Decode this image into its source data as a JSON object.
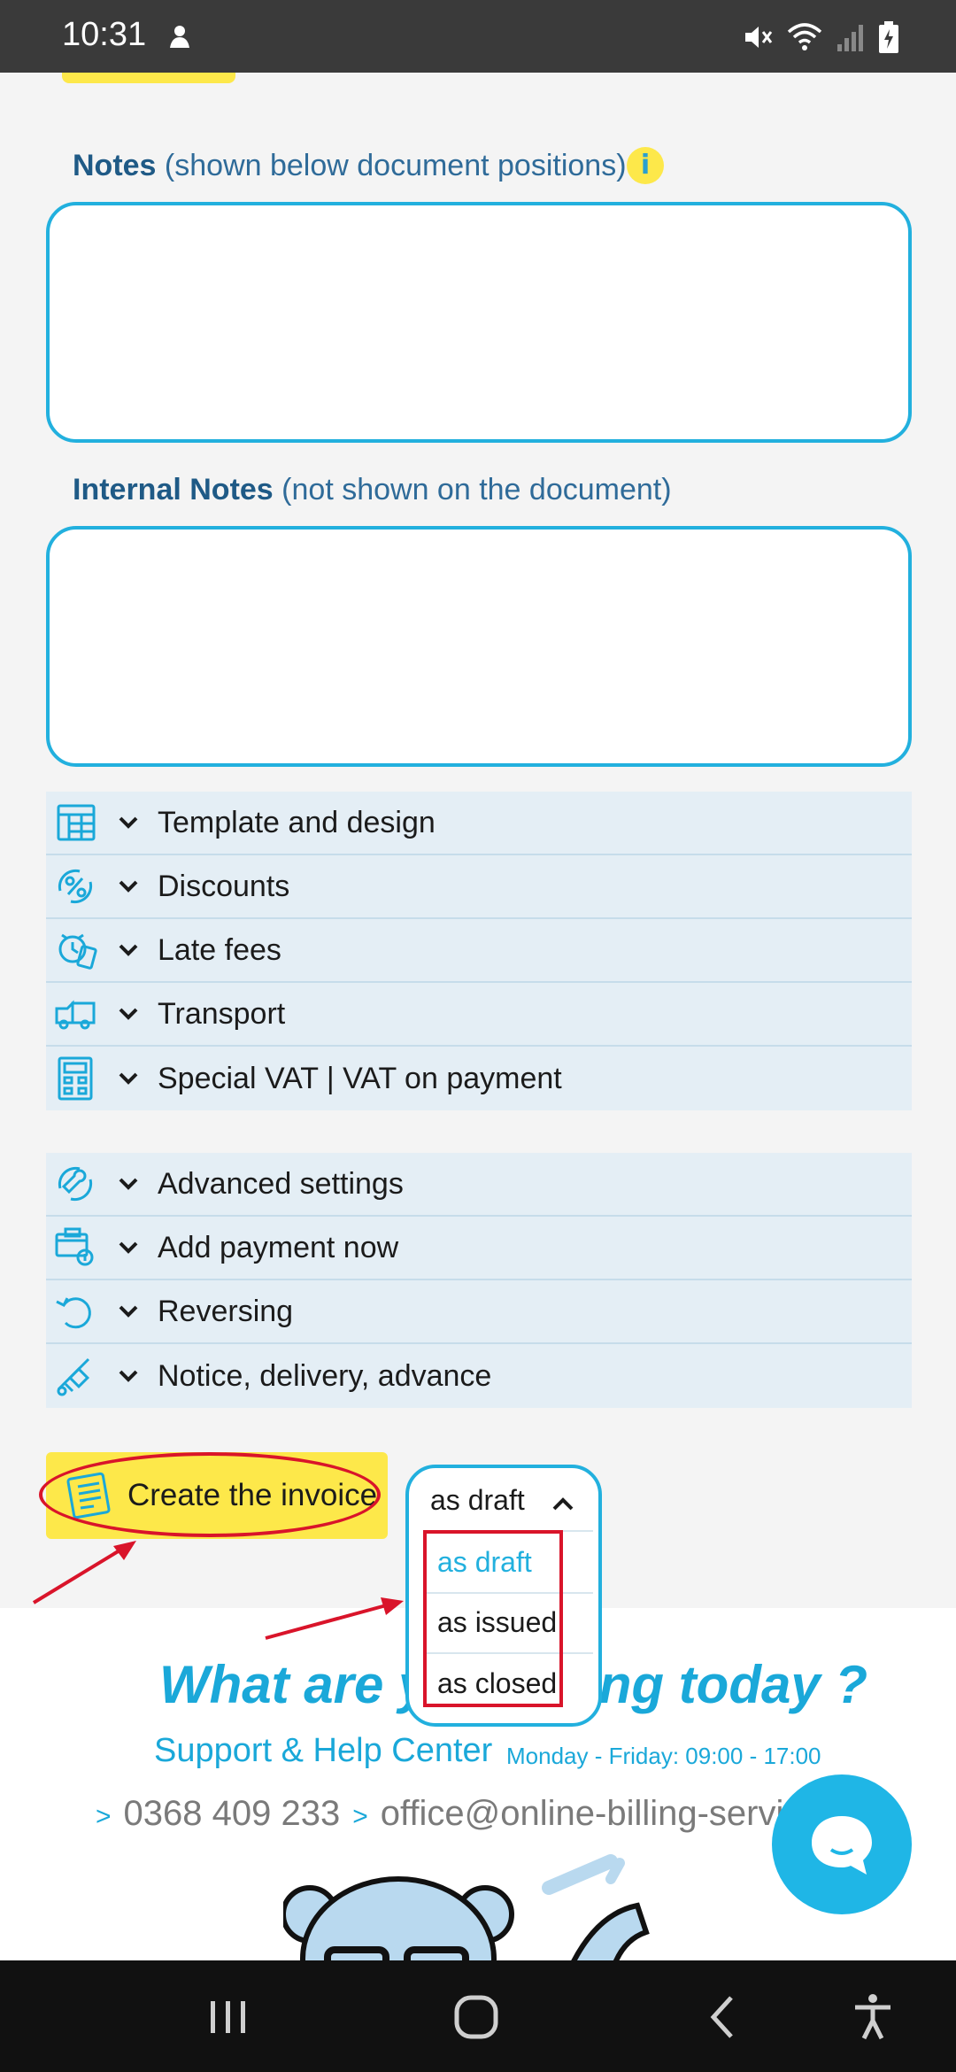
{
  "status_bar": {
    "time": "10:31"
  },
  "notes": {
    "label_bold": "Notes",
    "label_hint": "(shown below document positions)",
    "info_glyph": "i",
    "value": ""
  },
  "internal_notes": {
    "label_bold": "Internal Notes",
    "label_hint": "(not shown on the document)",
    "value": ""
  },
  "accordion_group_1": [
    {
      "label": "Template and design",
      "icon": "template-grid-icon"
    },
    {
      "label": "Discounts",
      "icon": "discount-percent-icon"
    },
    {
      "label": "Late fees",
      "icon": "late-fee-clock-icon"
    },
    {
      "label": "Transport",
      "icon": "truck-icon"
    },
    {
      "label": "Special VAT | VAT on payment",
      "icon": "calculator-icon"
    }
  ],
  "accordion_group_2": [
    {
      "label": "Advanced settings",
      "icon": "wrench-icon"
    },
    {
      "label": "Add payment now",
      "icon": "payment-card-icon"
    },
    {
      "label": "Reversing",
      "icon": "reverse-arrow-icon"
    },
    {
      "label": "Notice, delivery, advance",
      "icon": "hand-truck-icon"
    }
  ],
  "create_button": {
    "label": "Create the invoice"
  },
  "status_select": {
    "current": "as draft",
    "options": [
      "as draft",
      "as issued",
      "as closed"
    ],
    "selected_index": 0
  },
  "footer": {
    "heading": "What are you billing today ?",
    "support": "Support & Help Center",
    "hours": "Monday - Friday: 09:00 - 17:00",
    "phone": "0368 409 233",
    "email": "office@online-billing-service.com"
  },
  "colors": {
    "accent_blue": "#22b0de",
    "yellow": "#fde84a",
    "annotation_red": "#d9142a",
    "label_blue": "#1f5a86"
  }
}
